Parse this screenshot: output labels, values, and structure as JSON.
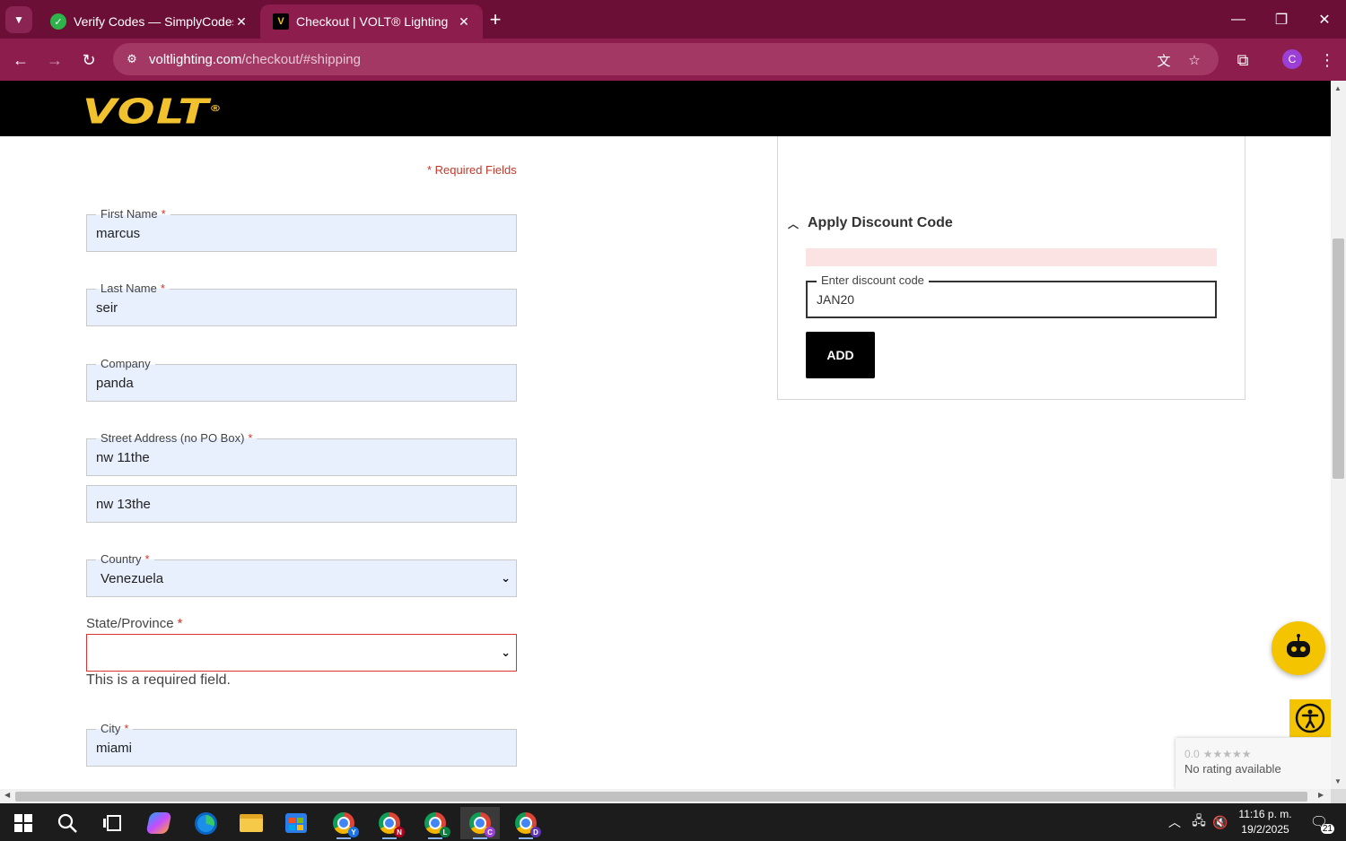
{
  "browser": {
    "tabs": [
      {
        "title": "Verify Codes — SimplyCodes",
        "active": false
      },
      {
        "title": "Checkout | VOLT® Lighting",
        "active": true
      }
    ],
    "url_host": "voltlighting.com",
    "url_path": "/checkout/#shipping",
    "profile_initial": "C"
  },
  "header": {
    "logo_text": "VOLT",
    "logo_mark": "®"
  },
  "form": {
    "required_note": "* Required Fields",
    "req_mark": "*",
    "first_name": {
      "label": "First Name",
      "value": "marcus"
    },
    "last_name": {
      "label": "Last Name",
      "value": "seir"
    },
    "company": {
      "label": "Company",
      "value": "panda"
    },
    "street": {
      "label": "Street Address (no PO Box)",
      "value": "nw 11the",
      "line2": "nw 13the"
    },
    "country": {
      "label": "Country",
      "value": "Venezuela"
    },
    "state": {
      "label": "State/Province",
      "value": "",
      "error": "This is a required field."
    },
    "city": {
      "label": "City",
      "value": "miami"
    }
  },
  "discount": {
    "title": "Apply Discount Code",
    "field_label": "Enter discount code",
    "field_value": "JAN20",
    "add_label": "ADD"
  },
  "rating_widget": {
    "score": "0.0",
    "text": "No rating available"
  },
  "taskbar": {
    "chrome_profiles": [
      "Y",
      "N",
      "L",
      "C",
      "D"
    ],
    "time": "11:16 p. m.",
    "date": "19/2/2025",
    "notifications": "21"
  },
  "colors": {
    "tab_strip": "#6b0f36",
    "toolbar": "#8d1d4c",
    "logo": "#f2c12e",
    "error": "#d0342c"
  }
}
